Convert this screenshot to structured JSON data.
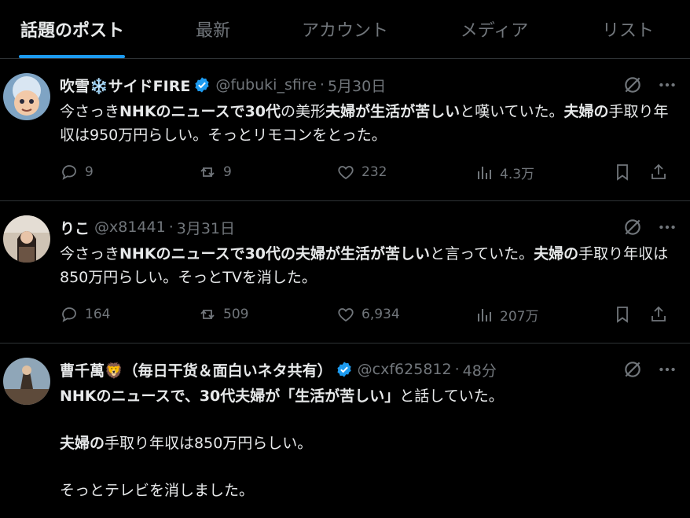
{
  "tabs": [
    {
      "label": "話題のポスト",
      "active": true
    },
    {
      "label": "最新",
      "active": false
    },
    {
      "label": "アカウント",
      "active": false
    },
    {
      "label": "メディア",
      "active": false
    },
    {
      "label": "リスト",
      "active": false
    }
  ],
  "colors": {
    "accent": "#1d9bf0",
    "muted": "#71767b",
    "text": "#e7e9ea",
    "bg": "#000000"
  },
  "posts": [
    {
      "name": "吹雪❄️サイドFIRE",
      "handle": "@fubuki_sfire",
      "time": "5月30日",
      "verified": true,
      "body": [
        {
          "t": "今さっき",
          "b": false
        },
        {
          "t": "NHKのニュースで30代",
          "b": true
        },
        {
          "t": "の美形",
          "b": false
        },
        {
          "t": "夫婦が生活が苦しい",
          "b": true
        },
        {
          "t": "と嘆いていた。",
          "b": false
        },
        {
          "t": "夫婦の",
          "b": true
        },
        {
          "t": "手取り年収は950万円らしい。そっとリモコンをとった。",
          "b": false
        }
      ],
      "replies": "9",
      "reposts": "9",
      "likes": "232",
      "views": "4.3万"
    },
    {
      "name": "りこ",
      "handle": "@x81441",
      "time": "3月31日",
      "verified": false,
      "body": [
        {
          "t": "今さっき",
          "b": false
        },
        {
          "t": "NHKのニュースで30代の夫婦が生活が苦しい",
          "b": true
        },
        {
          "t": "と言っていた。",
          "b": false
        },
        {
          "t": "夫婦の",
          "b": true
        },
        {
          "t": "手取り年収は850万円らしい。そっとTVを消した。",
          "b": false
        }
      ],
      "replies": "164",
      "reposts": "509",
      "likes": "6,934",
      "views": "207万"
    },
    {
      "name": "曹千萬🦁（毎日干货＆面白いネタ共有）",
      "handle": "@cxf625812",
      "time": "48分",
      "verified": true,
      "body_lines": [
        [
          {
            "t": "NHKのニュースで、30代夫婦が「生活が苦しい」",
            "b": true
          },
          {
            "t": "と話していた。",
            "b": false
          }
        ],
        [
          {
            "t": "夫婦の",
            "b": true
          },
          {
            "t": "手取り年収は850万円らしい。",
            "b": false
          }
        ],
        [
          {
            "t": "そっとテレビを消しました。",
            "b": false
          }
        ]
      ]
    }
  ]
}
